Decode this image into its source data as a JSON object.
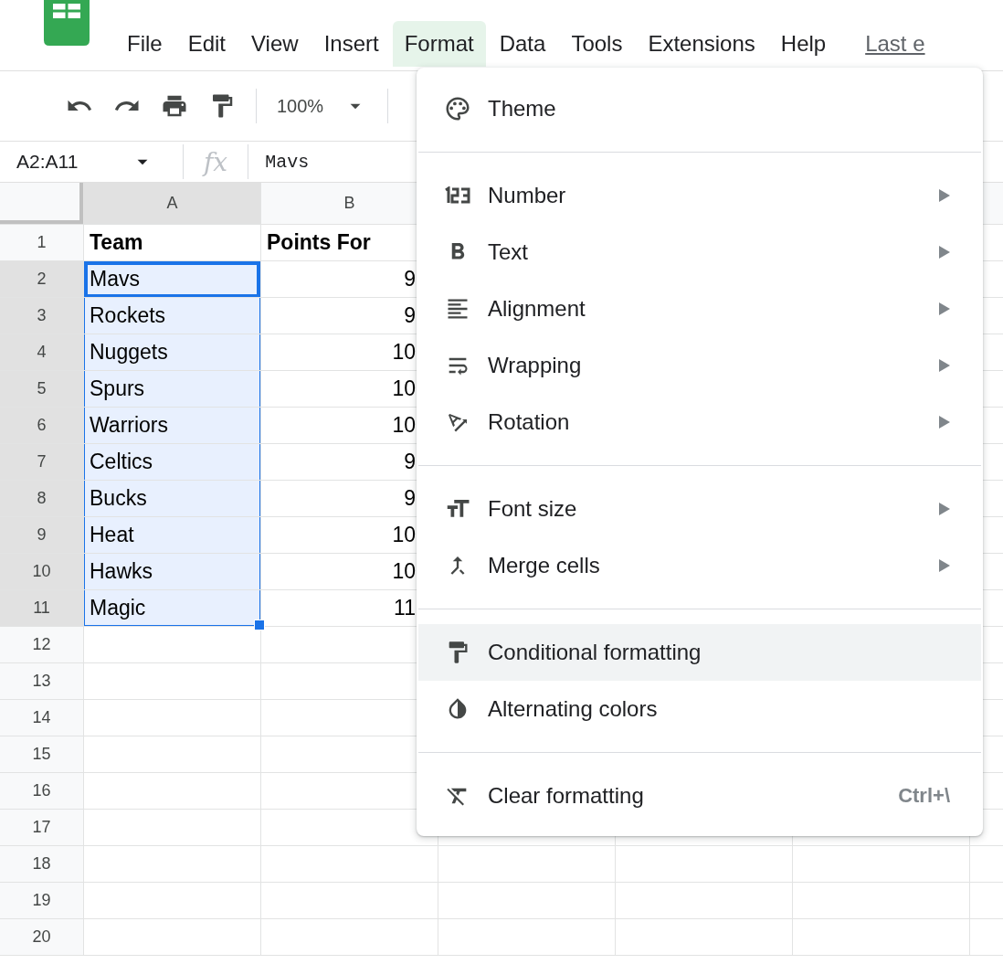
{
  "menu_bar": {
    "items": [
      {
        "label": "File",
        "selected": false
      },
      {
        "label": "Edit",
        "selected": false
      },
      {
        "label": "View",
        "selected": false
      },
      {
        "label": "Insert",
        "selected": false
      },
      {
        "label": "Format",
        "selected": true
      },
      {
        "label": "Data",
        "selected": false
      },
      {
        "label": "Tools",
        "selected": false
      },
      {
        "label": "Extensions",
        "selected": false
      },
      {
        "label": "Help",
        "selected": false
      }
    ],
    "last_edit": "Last e"
  },
  "toolbar": {
    "zoom": "100%"
  },
  "formula_bar": {
    "name_box": "A2:A11",
    "function_label": "fx",
    "value": "Mavs"
  },
  "sheet": {
    "columns": [
      {
        "label": "A",
        "selected": true
      },
      {
        "label": "B",
        "selected": false
      }
    ],
    "rows": [
      {
        "number": "1",
        "kind": "header",
        "selected": false,
        "active": false,
        "cells": [
          "Team",
          "Points For"
        ]
      },
      {
        "number": "2",
        "kind": "data",
        "selected": true,
        "active": true,
        "cells": [
          "Mavs",
          "9"
        ]
      },
      {
        "number": "3",
        "kind": "data",
        "selected": true,
        "active": false,
        "cells": [
          "Rockets",
          "9"
        ]
      },
      {
        "number": "4",
        "kind": "data",
        "selected": true,
        "active": false,
        "cells": [
          "Nuggets",
          "10"
        ]
      },
      {
        "number": "5",
        "kind": "data",
        "selected": true,
        "active": false,
        "cells": [
          "Spurs",
          "10"
        ]
      },
      {
        "number": "6",
        "kind": "data",
        "selected": true,
        "active": false,
        "cells": [
          "Warriors",
          "10"
        ]
      },
      {
        "number": "7",
        "kind": "data",
        "selected": true,
        "active": false,
        "cells": [
          "Celtics",
          "9"
        ]
      },
      {
        "number": "8",
        "kind": "data",
        "selected": true,
        "active": false,
        "cells": [
          "Bucks",
          "9"
        ]
      },
      {
        "number": "9",
        "kind": "data",
        "selected": true,
        "active": false,
        "cells": [
          "Heat",
          "10"
        ]
      },
      {
        "number": "10",
        "kind": "data",
        "selected": true,
        "active": false,
        "cells": [
          "Hawks",
          "10"
        ]
      },
      {
        "number": "11",
        "kind": "data",
        "selected": true,
        "active": false,
        "cells": [
          "Magic",
          "11"
        ]
      },
      {
        "number": "12",
        "kind": "empty",
        "selected": false,
        "active": false
      },
      {
        "number": "13",
        "kind": "empty",
        "selected": false,
        "active": false
      },
      {
        "number": "14",
        "kind": "empty",
        "selected": false,
        "active": false
      },
      {
        "number": "15",
        "kind": "empty",
        "selected": false,
        "active": false
      },
      {
        "number": "16",
        "kind": "empty",
        "selected": false,
        "active": false
      },
      {
        "number": "17",
        "kind": "empty",
        "selected": false,
        "active": false
      },
      {
        "number": "18",
        "kind": "empty",
        "selected": false,
        "active": false
      },
      {
        "number": "19",
        "kind": "empty",
        "selected": false,
        "active": false
      },
      {
        "number": "20",
        "kind": "empty",
        "selected": false,
        "active": false
      }
    ]
  },
  "format_menu": {
    "sections": [
      {
        "items": [
          {
            "label": "Theme",
            "submenu": false,
            "highlighted": false
          }
        ]
      },
      {
        "items": [
          {
            "label": "Number",
            "submenu": true,
            "highlighted": false
          },
          {
            "label": "Text",
            "submenu": true,
            "highlighted": false
          },
          {
            "label": "Alignment",
            "submenu": true,
            "highlighted": false
          },
          {
            "label": "Wrapping",
            "submenu": true,
            "highlighted": false
          },
          {
            "label": "Rotation",
            "submenu": true,
            "highlighted": false
          }
        ]
      },
      {
        "items": [
          {
            "label": "Font size",
            "submenu": true,
            "highlighted": false
          },
          {
            "label": "Merge cells",
            "submenu": true,
            "highlighted": false
          }
        ]
      },
      {
        "items": [
          {
            "label": "Conditional formatting",
            "submenu": false,
            "highlighted": true
          },
          {
            "label": "Alternating colors",
            "submenu": false,
            "highlighted": false
          }
        ]
      },
      {
        "items": [
          {
            "label": "Clear formatting",
            "submenu": false,
            "highlighted": false,
            "shortcut": "Ctrl+\\"
          }
        ]
      }
    ]
  }
}
